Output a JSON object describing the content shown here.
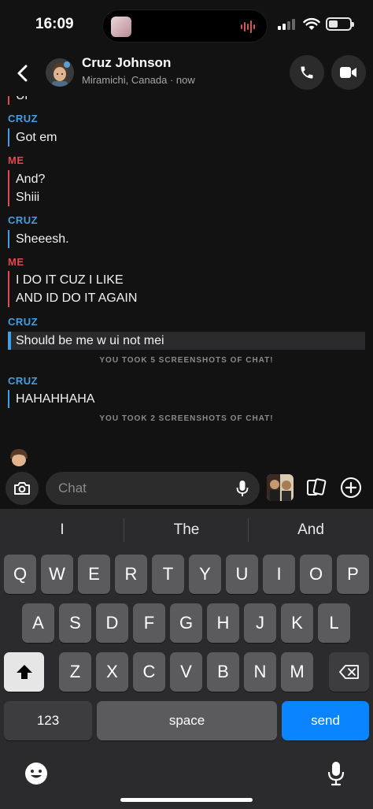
{
  "status_bar": {
    "time": "16:09"
  },
  "header": {
    "contact_name": "Cruz Johnson",
    "subtitle": "Miramichi, Canada · now"
  },
  "messages": [
    {
      "sender": "CRUZ",
      "lines": [
        "Got em"
      ]
    },
    {
      "sender": "ME",
      "lines": [
        "And?",
        "Shiii"
      ]
    },
    {
      "sender": "CRUZ",
      "lines": [
        "Sheeesh."
      ]
    },
    {
      "sender": "ME",
      "lines": [
        "I DO IT CUZ I LIKE",
        "AND ID DO IT AGAIN"
      ]
    },
    {
      "sender": "CRUZ",
      "lines": [
        "Should be me w ui not mei"
      ]
    },
    {
      "sender": "CRUZ",
      "lines": [
        "HAHAHHAHA"
      ]
    }
  ],
  "partial_top_text": "Ui",
  "notices": [
    "YOU TOOK 5 SCREENSHOTS OF CHAT!",
    "YOU TOOK 2 SCREENSHOTS OF CHAT!"
  ],
  "composer": {
    "placeholder": "Chat"
  },
  "keyboard": {
    "suggestions": [
      "I",
      "The",
      "And"
    ],
    "row1": [
      "Q",
      "W",
      "E",
      "R",
      "T",
      "Y",
      "U",
      "I",
      "O",
      "P"
    ],
    "row2": [
      "A",
      "S",
      "D",
      "F",
      "G",
      "H",
      "J",
      "K",
      "L"
    ],
    "row3": [
      "Z",
      "X",
      "C",
      "V",
      "B",
      "N",
      "M"
    ],
    "numbers_label": "123",
    "space_label": "space",
    "send_label": "send"
  },
  "colors": {
    "cruz": "#3fa0e6",
    "me": "#e5484d",
    "send_button": "#0a84ff"
  },
  "icons": [
    "back-chevron-icon",
    "phone-icon",
    "video-icon",
    "camera-icon",
    "microphone-icon",
    "cards-icon",
    "plus-icon",
    "emoji-icon",
    "shift-icon",
    "backspace-icon"
  ]
}
